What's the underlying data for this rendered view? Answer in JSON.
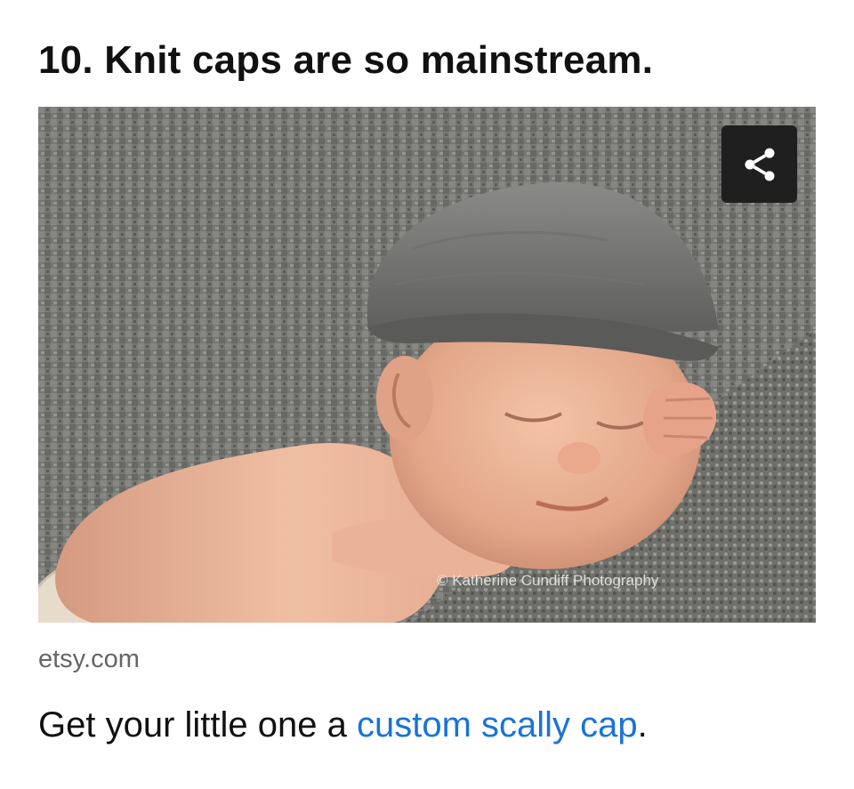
{
  "article": {
    "heading": "10. Knit caps are so mainstream.",
    "image": {
      "subject": "baby-photo",
      "watermark": "© Katherine Cundiff Photography"
    },
    "share_icon": "share-icon",
    "source": "etsy.com",
    "caption": {
      "prefix": "Get your little one a ",
      "link_text": "custom scally cap",
      "suffix": "."
    }
  },
  "colors": {
    "link": "#1a73d6",
    "share_button_bg": "#1f1f1f",
    "source_text": "#666666"
  }
}
